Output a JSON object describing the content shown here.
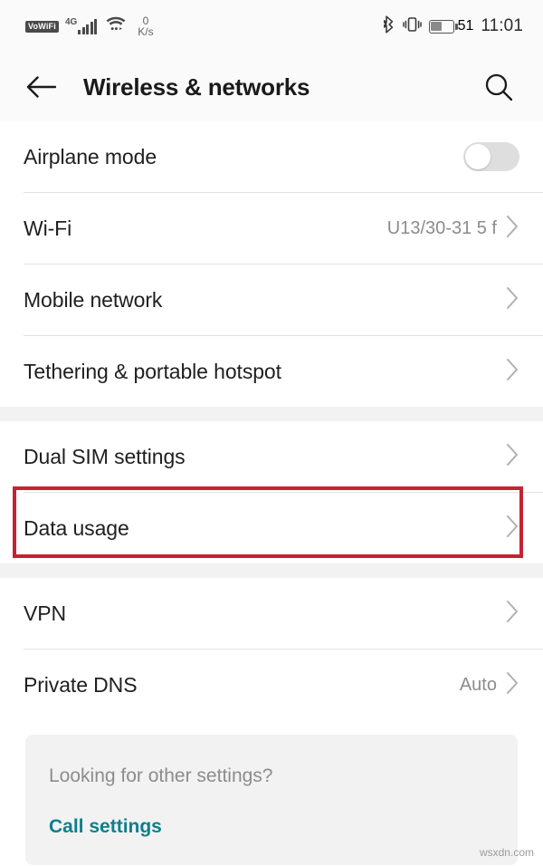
{
  "statusbar": {
    "vowifi_badge": "VoWiFi",
    "network_type": "4G",
    "signal_icon": "signal-bars-icon",
    "wifi_icon": "wifi-icon",
    "data_rate_value": "0",
    "data_rate_unit": "K/s",
    "bluetooth_icon": "bluetooth-icon",
    "vibrate_icon": "vibrate-icon",
    "battery_level": "51",
    "battery_percent": 51,
    "time": "11:01"
  },
  "header": {
    "back_icon": "back-arrow-icon",
    "title": "Wireless & networks",
    "search_icon": "search-icon"
  },
  "sections": [
    {
      "rows": [
        {
          "label": "Airplane mode",
          "control": "toggle",
          "toggle_on": false
        },
        {
          "label": "Wi-Fi",
          "value": "U13/30-31 5 f",
          "control": "chevron"
        },
        {
          "label": "Mobile network",
          "value": "",
          "control": "chevron"
        },
        {
          "label": "Tethering & portable hotspot",
          "value": "",
          "control": "chevron"
        }
      ]
    },
    {
      "rows": [
        {
          "label": "Dual SIM settings",
          "value": "",
          "control": "chevron"
        },
        {
          "label": "Data usage",
          "value": "",
          "control": "chevron",
          "highlighted": true
        }
      ]
    },
    {
      "rows": [
        {
          "label": "VPN",
          "value": "",
          "control": "chevron"
        },
        {
          "label": "Private DNS",
          "value": "Auto",
          "control": "chevron"
        }
      ]
    }
  ],
  "footer_card": {
    "question": "Looking for other settings?",
    "link_label": "Call settings"
  },
  "watermark": "wsxdn.com",
  "colors": {
    "highlight_border": "#c62233",
    "link": "#0e7f8c",
    "background": "#ffffff",
    "chrome": "#fafafa",
    "gap": "#f2f2f2",
    "label_text": "#1f1f1f",
    "value_text": "#8c8c8c"
  }
}
